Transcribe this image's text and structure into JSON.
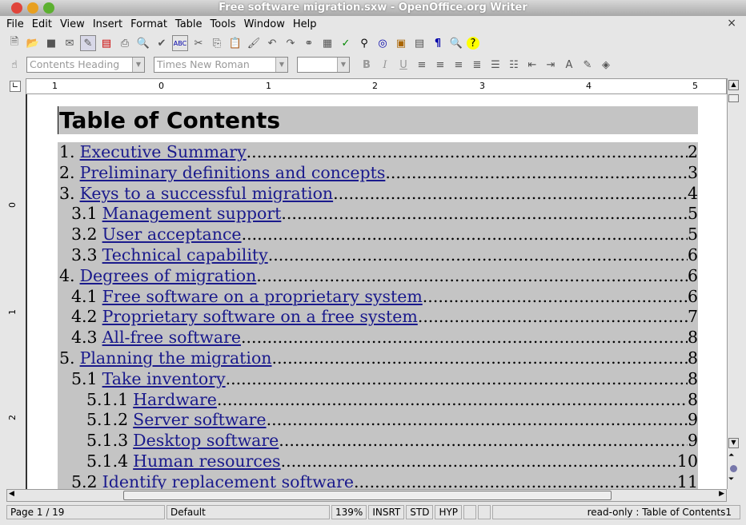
{
  "window": {
    "title": "Free software migration.sxw - OpenOffice.org Writer",
    "close": "×"
  },
  "menu": [
    "File",
    "Edit",
    "View",
    "Insert",
    "Format",
    "Table",
    "Tools",
    "Window",
    "Help"
  ],
  "format_toolbar": {
    "paragraph_style": "Contents Heading",
    "font_name": "Times New Roman",
    "font_size": "",
    "bold": "B",
    "italic": "I",
    "underline": "U"
  },
  "ruler": {
    "ticks": [
      "1",
      "0",
      "1",
      "2",
      "3",
      "4",
      "5"
    ]
  },
  "vruler": {
    "ticks": [
      "0",
      "1",
      "2"
    ]
  },
  "toc": {
    "heading": "Table of Contents",
    "entries": [
      {
        "num": "1.",
        "title": "Executive Summary",
        "page": "2",
        "level": 1
      },
      {
        "num": "2.",
        "title": "Preliminary definitions and concepts",
        "page": "3",
        "level": 1
      },
      {
        "num": "3.",
        "title": "Keys to a successful migration",
        "page": "4",
        "level": 1
      },
      {
        "num": "3.1",
        "title": "Management support",
        "page": "5",
        "level": 2
      },
      {
        "num": "3.2",
        "title": "User acceptance",
        "page": "5",
        "level": 2
      },
      {
        "num": "3.3",
        "title": "Technical capability",
        "page": "6",
        "level": 2
      },
      {
        "num": "4.",
        "title": "Degrees of migration",
        "page": "6",
        "level": 1
      },
      {
        "num": "4.1",
        "title": "Free software on a proprietary system",
        "page": "6",
        "level": 2
      },
      {
        "num": "4.2",
        "title": "Proprietary software on a free system",
        "page": "7",
        "level": 2
      },
      {
        "num": "4.3",
        "title": "All-free software",
        "page": "8",
        "level": 2
      },
      {
        "num": "5.",
        "title": "Planning the migration",
        "page": "8",
        "level": 1
      },
      {
        "num": "5.1",
        "title": "Take inventory",
        "page": "8",
        "level": 2
      },
      {
        "num": "5.1.1",
        "title": "Hardware",
        "page": "8",
        "level": 3
      },
      {
        "num": "5.1.2",
        "title": "Server software",
        "page": "9",
        "level": 3
      },
      {
        "num": "5.1.3",
        "title": "Desktop software",
        "page": "9",
        "level": 3
      },
      {
        "num": "5.1.4",
        "title": "Human resources",
        "page": "10",
        "level": 3
      },
      {
        "num": "5.2",
        "title": "Identify replacement software",
        "page": "11",
        "level": 2
      }
    ]
  },
  "status": {
    "page": "Page 1 / 19",
    "style": "Default",
    "zoom": "139%",
    "insert": "INSRT",
    "selection": "STD",
    "hyperlink": "HYP",
    "info": "read-only : Table of Contents1"
  }
}
